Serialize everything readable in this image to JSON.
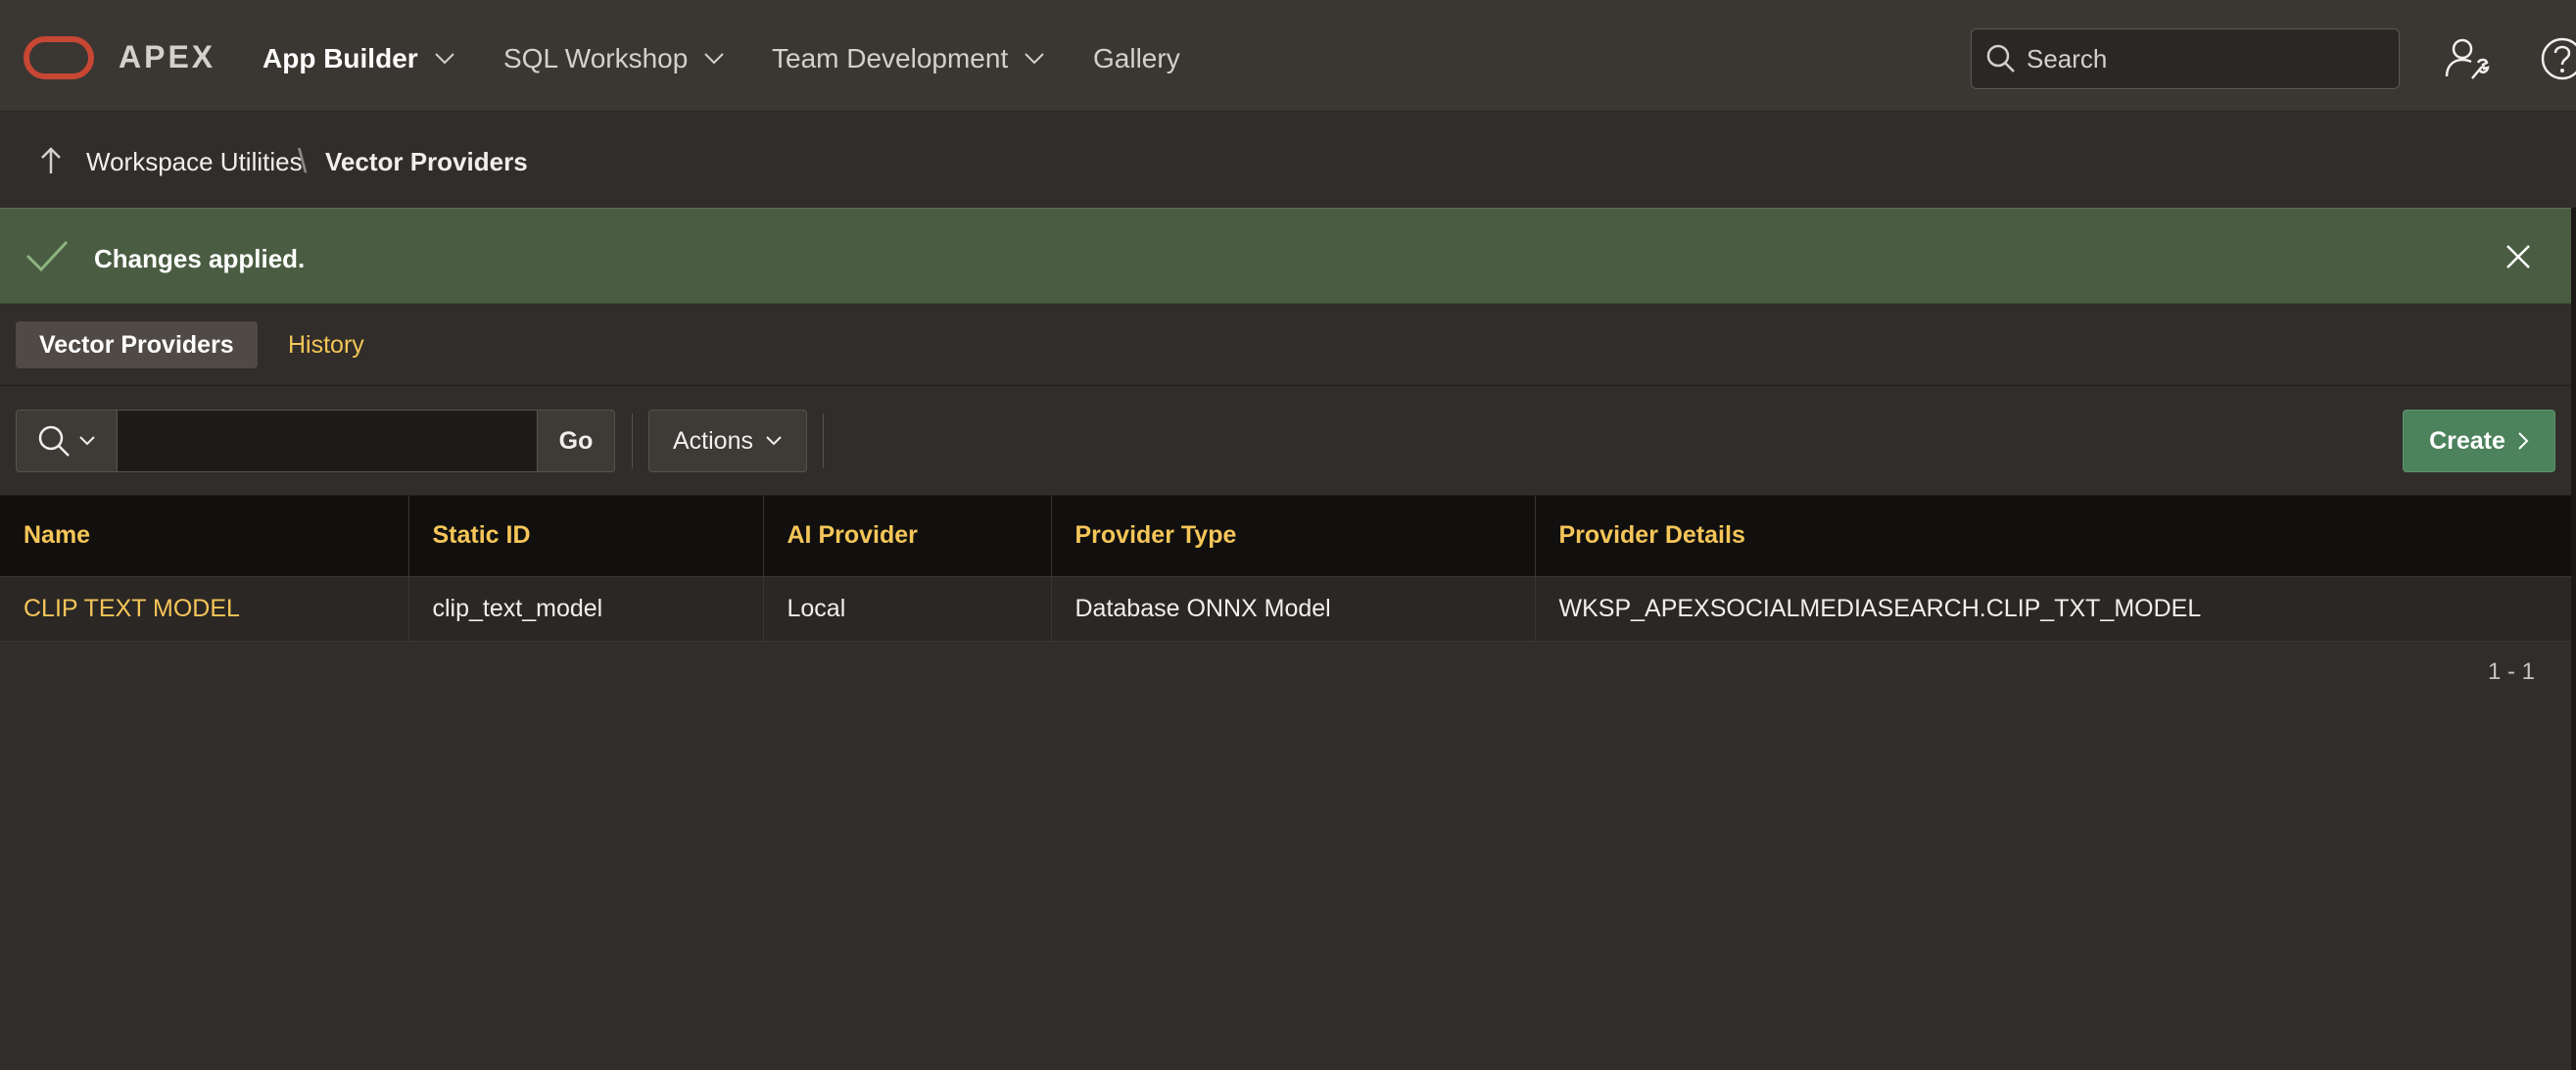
{
  "header": {
    "logo_text": "APEX",
    "nav": [
      {
        "label": "App Builder",
        "active": true
      },
      {
        "label": "SQL Workshop",
        "active": false
      },
      {
        "label": "Team Development",
        "active": false
      },
      {
        "label": "Gallery",
        "active": false
      }
    ],
    "search_placeholder": "Search",
    "icons": [
      "user-settings-icon",
      "help-icon"
    ]
  },
  "breadcrumb": {
    "parent": "Workspace Utilities",
    "separator": "\\",
    "current": "Vector Providers"
  },
  "alert": {
    "message": "Changes applied.",
    "color": "#4a5d42"
  },
  "tabs": [
    {
      "label": "Vector Providers",
      "selected": true
    },
    {
      "label": "History",
      "selected": false
    }
  ],
  "toolbar": {
    "search_value": "",
    "go_label": "Go",
    "actions_label": "Actions",
    "create_label": "Create"
  },
  "report": {
    "columns": [
      "Name",
      "Static ID",
      "AI Provider",
      "Provider Type",
      "Provider Details"
    ],
    "rows": [
      [
        "CLIP TEXT MODEL",
        "clip_text_model",
        "Local",
        "Database ONNX Model",
        "WKSP_APEXSOCIALMEDIASEARCH.CLIP_TXT_MODEL"
      ]
    ],
    "pagination": "1 - 1"
  },
  "colors": {
    "accent": "#f5c658",
    "create_button": "#4c825c",
    "logo": "#c74634"
  }
}
